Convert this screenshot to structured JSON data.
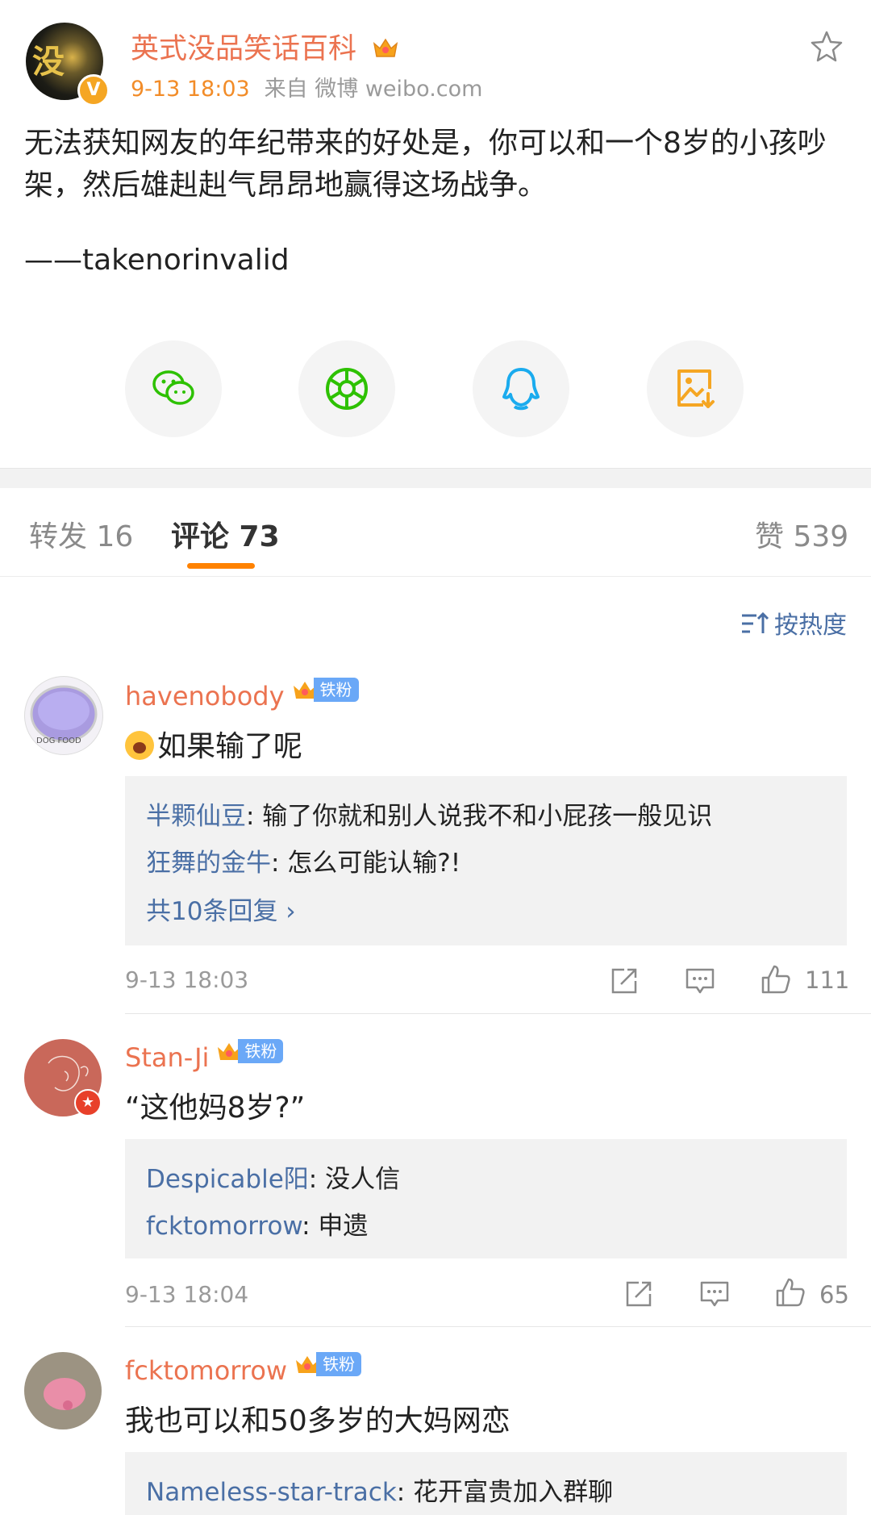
{
  "post": {
    "author": "英式没品笑话百科",
    "time": "9-13 18:03",
    "source": "来自 微博 weibo.com",
    "text": "无法获知网友的年纪带来的好处是，你可以和一个8岁的小孩吵架，然后雄赳赳气昂昂地赢得这场战争。",
    "attribution": "——takenorinvalid"
  },
  "share_buttons": [
    {
      "name": "wechat",
      "color": "#2dc100"
    },
    {
      "name": "moments",
      "color": "#2dc100"
    },
    {
      "name": "qq",
      "color": "#1aabee"
    },
    {
      "name": "save-image",
      "color": "#f5a623"
    }
  ],
  "tabs": {
    "repost": "转发 16",
    "comments": "评论 73",
    "likes": "赞 539"
  },
  "sort_label": "按热度",
  "comments": [
    {
      "user": "havenobody",
      "badge": "铁粉",
      "text": "如果输了呢",
      "replies": [
        {
          "user": "半颗仙豆",
          "text": ": 输了你就和别人说我不和小屁孩一般见识"
        },
        {
          "user": "狂舞的金牛",
          "text": ": 怎么可能认输?!"
        }
      ],
      "more": "共10条回复 ›",
      "time": "9-13 18:03",
      "likes": "111"
    },
    {
      "user": "Stan-Ji",
      "badge": "铁粉",
      "text": "“这他妈8岁?”",
      "replies": [
        {
          "user": "Despicable阳",
          "text": ": 没人信"
        },
        {
          "user": "fcktomorrow",
          "text": ": 申遗"
        }
      ],
      "time": "9-13 18:04",
      "likes": "65"
    },
    {
      "user": "fcktomorrow",
      "badge": "铁粉",
      "text": "我也可以和50多岁的大妈网恋",
      "replies": [
        {
          "user": "Nameless-star-track",
          "text": ": 花开富贵加入群聊"
        }
      ]
    }
  ]
}
